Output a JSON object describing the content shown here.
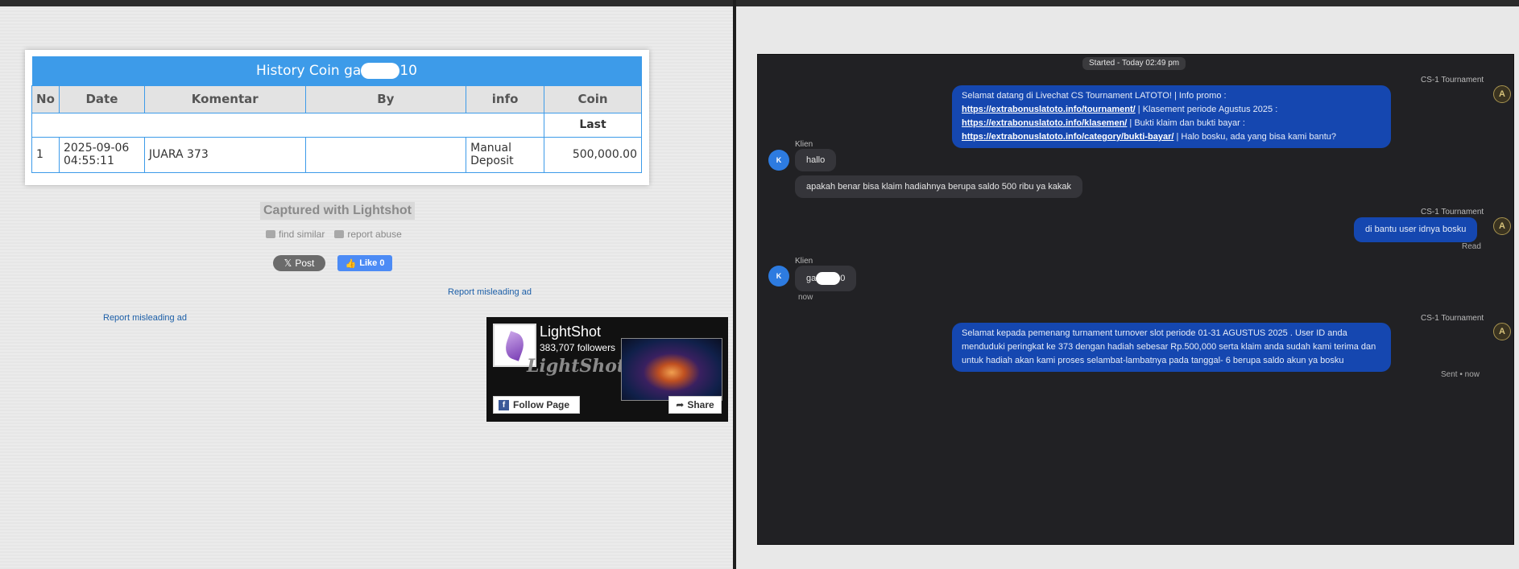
{
  "left": {
    "history": {
      "title_prefix": "History Coin ga",
      "title_suffix": "10",
      "columns": [
        "No",
        "Date",
        "Komentar",
        "By",
        "info",
        "Coin"
      ],
      "last_label": "Last",
      "row": {
        "no": "1",
        "date_line1": "2025-09-06",
        "date_line2": "04:55:11",
        "komentar": "JUARA 373",
        "by": "",
        "info_line1": "Manual",
        "info_line2": "Deposit",
        "coin": "500,000.00"
      }
    },
    "captured": "Captured with Lightshot",
    "find_similar": "find similar",
    "report_abuse": "report abuse",
    "post_label": "Post",
    "like_label": "Like 0",
    "report_ad_1": "Report misleading ad",
    "report_ad_2": "Report misleading ad",
    "fb": {
      "name": "LightShot",
      "followers": "383,707 followers",
      "brand": "LightShot",
      "follow_label": "Follow Page",
      "share_label": "Share"
    }
  },
  "chat": {
    "started": "Started - Today 02:49 pm",
    "agent_name": "CS-1 Tournament",
    "client_name": "Klien",
    "client_initial": "K",
    "agent_initial": "A",
    "msg1_a": "Selamat datang di Livechat CS Tournament LATOTO! | Info promo : ",
    "msg1_link1": "https://extrabonuslatoto.info/tournament/",
    "msg1_b": " | Klasement periode Agustus 2025 : ",
    "msg1_link2": "https://extrabonuslatoto.info/klasemen/",
    "msg1_c": " | Bukti klaim dan bukti bayar : ",
    "msg1_link3": "https://extrabonuslatoto.info/category/bukti-bayar/",
    "msg1_d": " | Halo bosku, ada yang bisa kami bantu?",
    "msg2": "hallo",
    "msg3": "apakah benar bisa klaim hadiahnya berupa saldo 500 ribu ya kakak",
    "msg4": "di bantu user idnya bosku",
    "msg4_status": "Read",
    "msg5_prefix": "ga",
    "msg5_suffix": "0",
    "msg5_time": "now",
    "msg6": "Selamat kepada pemenang turnament turnover slot periode 01-31 AGUSTUS 2025 . User ID anda menduduki peringkat ke 373 dengan hadiah sebesar Rp.500,000 serta klaim anda sudah kami terima dan untuk hadiah akan kami proses selambat-lambatnya pada tanggal- 6 berupa saldo akun ya bosku",
    "msg6_status": "Sent • now"
  }
}
